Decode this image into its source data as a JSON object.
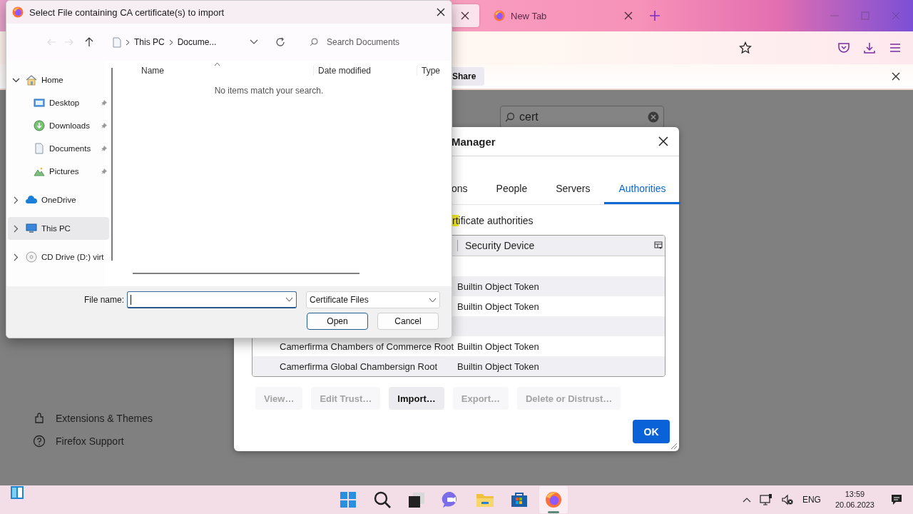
{
  "browser": {
    "tabs": [
      {
        "selected": true
      },
      {
        "label": "New Tab",
        "selected": false
      }
    ],
    "notification": {
      "button": "Share"
    },
    "settings_search": {
      "value": "cert"
    },
    "sidebar_links": [
      {
        "label": "Extensions & Themes"
      },
      {
        "label": "Firefox Support"
      }
    ]
  },
  "certificate_manager": {
    "title": "Manager",
    "tabs": [
      {
        "label": "ons",
        "selected": false
      },
      {
        "label": "People",
        "selected": false
      },
      {
        "label": "Servers",
        "selected": false
      },
      {
        "label": "Authorities",
        "selected": true
      }
    ],
    "description": {
      "highlight": "rt",
      "text": "ificate authorities"
    },
    "columns": [
      "Security Device"
    ],
    "rows": [
      {
        "kind": "group"
      },
      {
        "kind": "certificate",
        "device": "Builtin Object Token"
      },
      {
        "kind": "certificate",
        "device": "Builtin Object Token"
      },
      {
        "kind": "group"
      },
      {
        "kind": "certificate",
        "name": "Camerfirma Chambers of Commerce Root",
        "device": "Builtin Object Token"
      },
      {
        "kind": "certificate",
        "name": "Camerfirma Global Chambersign Root",
        "device": "Builtin Object Token"
      }
    ],
    "buttons": [
      {
        "label": "View…",
        "disabled": true
      },
      {
        "label": "Edit Trust…",
        "disabled": true
      },
      {
        "label": "Import…",
        "disabled": false
      },
      {
        "label": "Export…",
        "disabled": true
      },
      {
        "label": "Delete or Distrust…",
        "disabled": true
      }
    ],
    "ok": "OK"
  },
  "file_dialog": {
    "title": "Select File containing CA certificate(s) to import",
    "path": [
      "This PC",
      "Docume..."
    ],
    "search_placeholder": "Search Documents",
    "nav": [
      {
        "label": "Home",
        "expanded": true,
        "selected": false,
        "children": [
          {
            "label": "Desktop",
            "pinned": true,
            "selected": false
          },
          {
            "label": "Downloads",
            "pinned": true,
            "selected": false
          },
          {
            "label": "Documents",
            "pinned": true,
            "selected": false
          },
          {
            "label": "Pictures",
            "pinned": true,
            "selected": false
          }
        ]
      },
      {
        "label": "OneDrive",
        "expanded": false,
        "selected": false
      },
      {
        "label": "This PC",
        "expanded": false,
        "selected": true
      },
      {
        "label": "CD Drive (D:) virt",
        "expanded": false,
        "selected": false
      }
    ],
    "columns": [
      "Name",
      "Date modified",
      "Type"
    ],
    "empty_message": "No items match your search.",
    "file_name_label": "File name:",
    "filter": "Certificate Files",
    "buttons": [
      {
        "label": "Open",
        "default": true
      },
      {
        "label": "Cancel",
        "default": false
      }
    ]
  },
  "taskbar": {
    "apps": [
      {
        "active": false
      },
      {
        "active": false
      },
      {
        "active": false
      },
      {
        "active": false
      },
      {
        "active": false
      },
      {
        "active": false
      },
      {
        "active": true
      }
    ],
    "language": "ENG",
    "time": "13:59",
    "date": "20.06.2023"
  }
}
